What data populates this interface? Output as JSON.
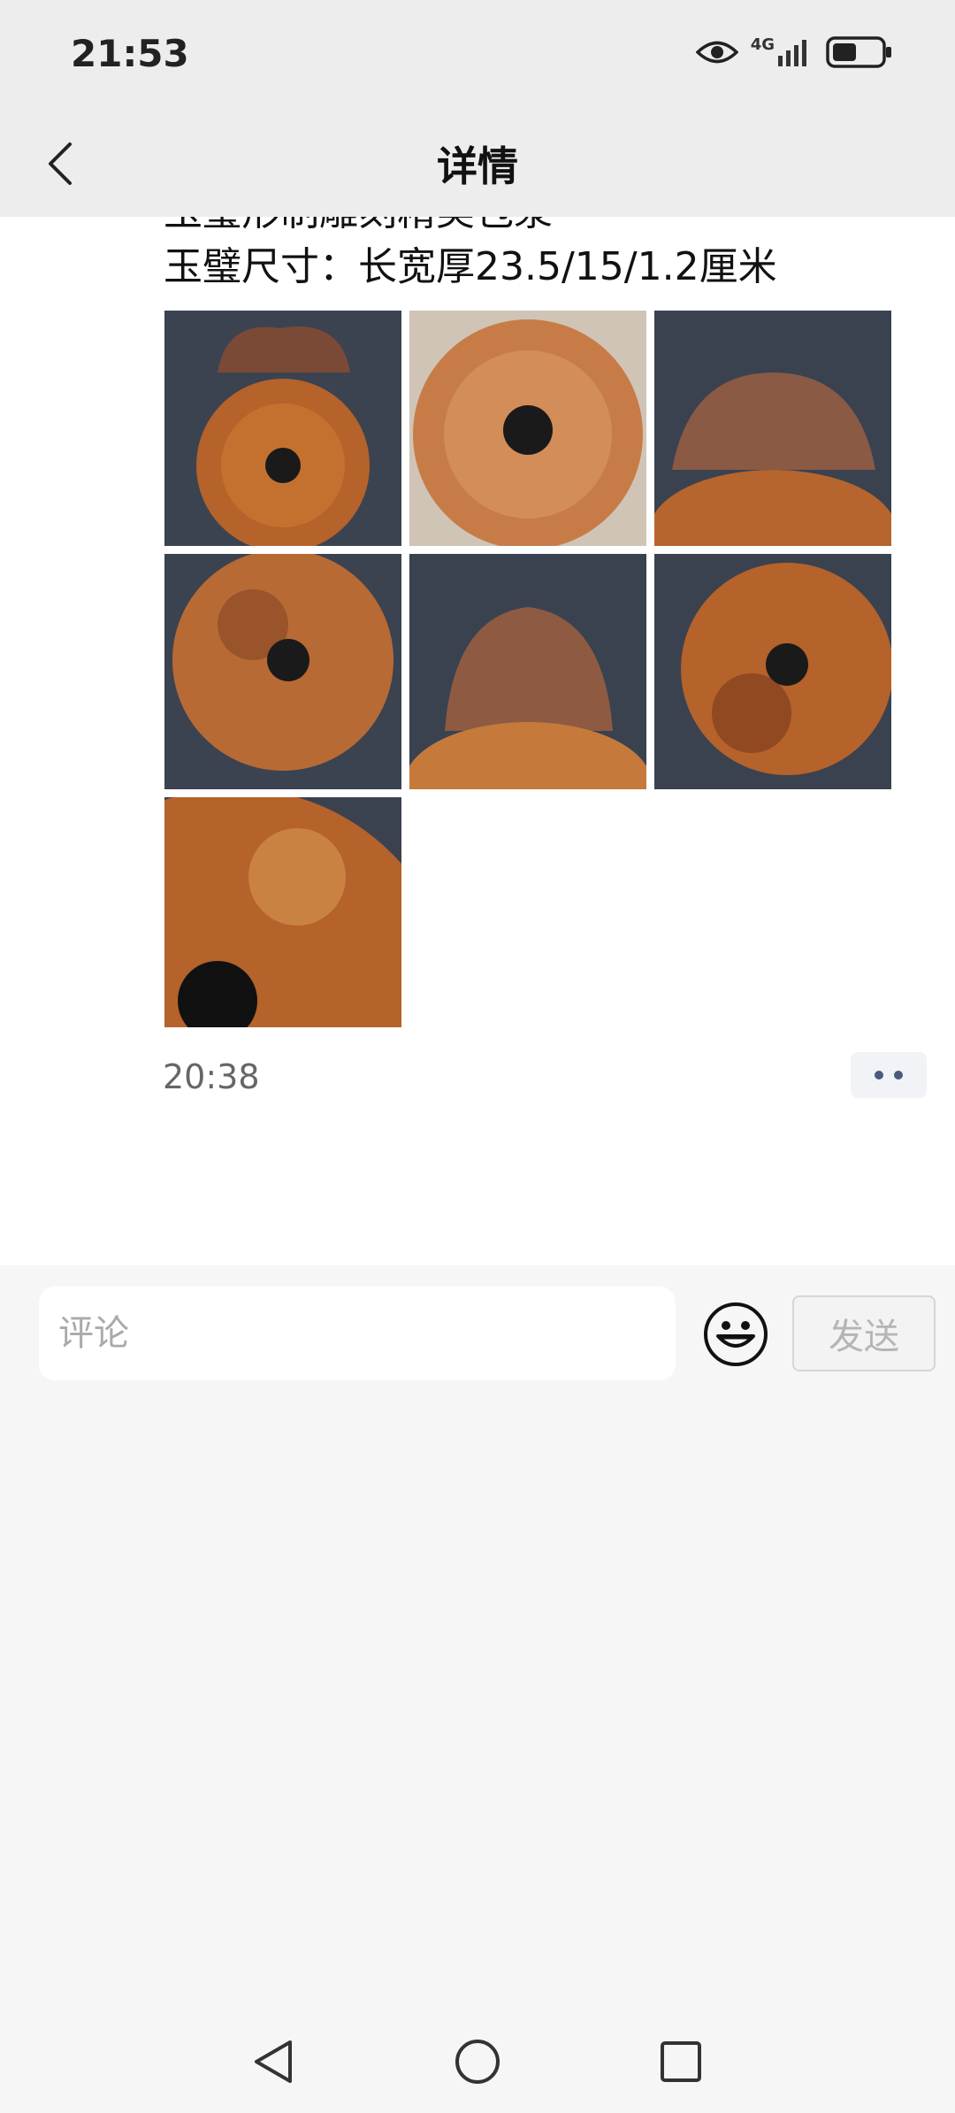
{
  "status": {
    "time": "21:53",
    "network": "4G"
  },
  "header": {
    "title": "详情"
  },
  "post": {
    "cut_line": "玉璧形制雕刻精美包浆",
    "description": "玉璧尺寸：长宽厚23.5/15/1.2厘米",
    "images": [
      {
        "name": "jade-bi-dragon-top"
      },
      {
        "name": "jade-bi-front"
      },
      {
        "name": "jade-bi-carved-crest"
      },
      {
        "name": "jade-bi-side"
      },
      {
        "name": "jade-bi-crest-detail"
      },
      {
        "name": "jade-bi-angled"
      },
      {
        "name": "jade-bi-closeup"
      }
    ],
    "time": "20:38"
  },
  "comment": {
    "placeholder": "评论",
    "send_label": "发送"
  },
  "colors": {
    "statusbar": "#ededed",
    "content": "#ffffff",
    "footer": "#f6f6f6",
    "accent_dots": "#4a5a7a"
  }
}
